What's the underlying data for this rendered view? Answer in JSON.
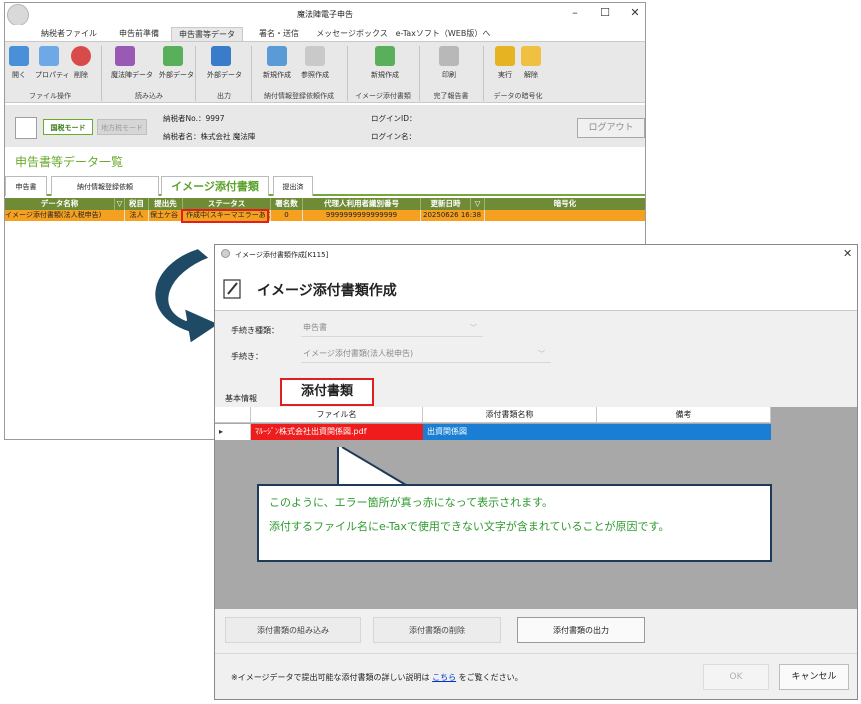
{
  "main_window": {
    "title": "魔法陣電子申告",
    "controls": {
      "minimize": "–",
      "maximize": "☐",
      "close": "✕"
    },
    "ribbon_tabs": [
      "納税者ファイル",
      "申告前準備",
      "申告書等データ",
      "署名・送信",
      "メッセージボックス",
      "e-Taxソフト（WEB版）へ"
    ],
    "ribbon_buttons": [
      "開く",
      "プロパティ",
      "削除",
      "魔法陣データ",
      "外部データ",
      "外部データ",
      "新規作成",
      "参照作成",
      "新規作成",
      "印刷",
      "実行",
      "解除"
    ],
    "ribbon_groups": [
      "ファイル操作",
      "読み込み",
      "出力",
      "納付情報登録依頼作成",
      "イメージ添付書類",
      "完了報告書",
      "データの暗号化"
    ],
    "mode_buttons": {
      "national": "国税モード",
      "local": "地方税モード"
    },
    "taxpayer": {
      "number_label": "納税者No.：",
      "number": "9997",
      "name_label": "納税者名：",
      "name": "株式会社 魔法陣"
    },
    "login_id_label": "ログインID：",
    "login_name_label": "ログイン名：",
    "logout_label": "ログアウト",
    "section_title": "申告書等データ一覧",
    "doc_tabs": [
      "申告書",
      "納付情報登録依頼",
      "イメージ添付書類",
      "提出済"
    ],
    "grid": {
      "headers": [
        "データ名称",
        "▽",
        "税目",
        "提出先",
        "ステータス",
        "署名数",
        "代理人利用者識別番号",
        "更新日時",
        "▽",
        "暗号化"
      ],
      "row": {
        "name": "イメージ添付書類(法人税申告)",
        "tax": "法人",
        "dest": "保土ケ谷",
        "status": "作成中(スキーマエラーあり)",
        "signatures": "0",
        "agent_id": "9999999999999999",
        "updated": "20250626 16:38",
        "encrypted": ""
      }
    }
  },
  "dialog": {
    "title": "イメージ添付書類作成[K115]",
    "close": "✕",
    "heading": "イメージ添付書類作成",
    "form": {
      "procedure_type_label": "手続き種類：",
      "procedure_type_value": "申告書",
      "procedure_label": "手続き：",
      "procedure_value": "イメージ添付書類(法人税申告)"
    },
    "tabs": {
      "basic": "基本情報",
      "attachments": "添付書類"
    },
    "grid": {
      "headers": [
        "ファイル名",
        "添付書類名称",
        "備考"
      ],
      "row": {
        "marker": "▸",
        "filename": "ﾏﾙｰｼﾞﾝ株式会社出資関係図.pdf",
        "doc_name": "出資関係図",
        "note": ""
      }
    },
    "buttons": {
      "embed": "添付書類の組み込み",
      "delete": "添付書類の削除",
      "output": "添付書類の出力"
    },
    "footer": {
      "note_prefix": "※イメージデータで提出可能な添付書類の詳しい説明は",
      "link": "こちら",
      "note_suffix": "をご覧ください。",
      "ok": "OK",
      "cancel": "キャンセル"
    }
  },
  "callout": {
    "line1": "このように、エラー箇所が真っ赤になって表示されます。",
    "line2": "添付するファイル名にe-Taxで使用できない文字が含まれていることが原因です。"
  },
  "colors": {
    "accent_green": "#6aab2c",
    "grid_header": "#6f8b35",
    "selected_row": "#f6a020",
    "error_red": "#e02020",
    "selection_blue": "#1a7fd4",
    "callout_text": "#2e9a2e",
    "arrow": "#1e4a66"
  }
}
